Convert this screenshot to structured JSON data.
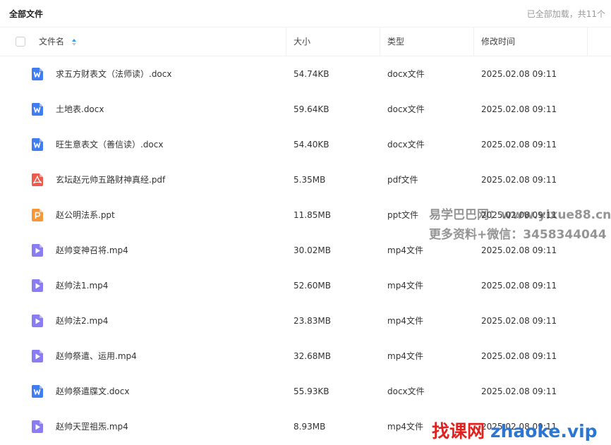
{
  "topbar": {
    "title": "全部文件",
    "status": "已全部加载，共11个"
  },
  "columns": {
    "name": "文件名",
    "size": "大小",
    "type": "类型",
    "modified": "修改时间"
  },
  "colors": {
    "word": "#3f7ef2",
    "pdf": "#f05a4a",
    "ppt": "#f6973a",
    "video": "#8a7cf3",
    "sort_active": "#2d9cf2"
  },
  "files": [
    {
      "name": "求五方财表文（法师读）.docx",
      "size": "54.74KB",
      "type": "docx文件",
      "modified": "2025.02.08 09:11",
      "icon": "word-file-icon"
    },
    {
      "name": "土地表.docx",
      "size": "59.64KB",
      "type": "docx文件",
      "modified": "2025.02.08 09:11",
      "icon": "word-file-icon"
    },
    {
      "name": "旺生意表文（善信读）.docx",
      "size": "54.40KB",
      "type": "docx文件",
      "modified": "2025.02.08 09:11",
      "icon": "word-file-icon"
    },
    {
      "name": "玄坛赵元帅五路财神真经.pdf",
      "size": "5.35MB",
      "type": "pdf文件",
      "modified": "2025.02.08 09:11",
      "icon": "pdf-file-icon"
    },
    {
      "name": "赵公明法系.ppt",
      "size": "11.85MB",
      "type": "ppt文件",
      "modified": "2025.02.08 09:11",
      "icon": "ppt-file-icon"
    },
    {
      "name": "赵帅变神召将.mp4",
      "size": "30.02MB",
      "type": "mp4文件",
      "modified": "2025.02.08 09:11",
      "icon": "video-file-icon"
    },
    {
      "name": "赵帅法1.mp4",
      "size": "52.60MB",
      "type": "mp4文件",
      "modified": "2025.02.08 09:11",
      "icon": "video-file-icon"
    },
    {
      "name": "赵帅法2.mp4",
      "size": "23.83MB",
      "type": "mp4文件",
      "modified": "2025.02.08 09:11",
      "icon": "video-file-icon"
    },
    {
      "name": "赵帅祭遣、运用.mp4",
      "size": "32.68MB",
      "type": "mp4文件",
      "modified": "2025.02.08 09:11",
      "icon": "video-file-icon"
    },
    {
      "name": "赵帅祭遣牒文.docx",
      "size": "55.93KB",
      "type": "docx文件",
      "modified": "2025.02.08 09:11",
      "icon": "word-file-icon"
    },
    {
      "name": "赵帅天罡祖炁.mp4",
      "size": "8.93MB",
      "type": "mp4文件",
      "modified": "2025.02.08 09:11",
      "icon": "video-file-icon"
    }
  ],
  "watermarks": {
    "line1": "易学巴巴网：www.yixue88.cn",
    "line2": "更多资料+微信：3458344044",
    "brand_cn": "找课网",
    "brand_url": "zhaoke.vip"
  }
}
